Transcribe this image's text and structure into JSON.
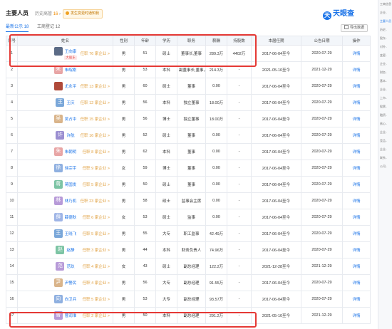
{
  "header": {
    "title": "主要人员",
    "history_label": "历史高管",
    "history_count": "16",
    "notice": "发生变更时通知我",
    "logo": "天眼查"
  },
  "tabs": [
    {
      "label": "最新公示 18",
      "active": true
    },
    {
      "label": "工商登记 12",
      "active": false
    }
  ],
  "export_label": "导出数据",
  "table": {
    "headers": [
      "序号",
      "姓名",
      "性别",
      "年龄",
      "学历",
      "职务",
      "薪酬",
      "持股数",
      "本届任期",
      "公告日期",
      "操作"
    ],
    "rows": [
      {
        "no": "1",
        "avatar_text": "",
        "avatar_color": "#5b6b86",
        "name": "王向康",
        "tag": "大股东",
        "companies": "任职 76 家企业 >",
        "gender": "男",
        "age": "51",
        "edu": "硕士",
        "role": "董事长,董事",
        "pay": "289.3万",
        "shares": "4402万",
        "term": "2017-06-04至今",
        "date": "2020-07-29",
        "op": "详情"
      },
      {
        "no": "2",
        "avatar_text": "朱",
        "avatar_color": "#e8a5a5",
        "name": "朱皖刚",
        "tag": "",
        "companies": "",
        "gender": "男",
        "age": "53",
        "edu": "本科",
        "role": "副董事长,董事,总经理",
        "pay": "214.3万",
        "shares": "-",
        "term": "2021-05-10至今",
        "date": "2021-12-29",
        "op": "详情"
      },
      {
        "no": "3",
        "avatar_text": "",
        "avatar_color": "#b04a3a",
        "name": "尤永平",
        "tag": "",
        "companies": "任职 13 家企业 >",
        "gender": "男",
        "age": "60",
        "edu": "硕士",
        "role": "董事",
        "pay": "0.00",
        "shares": "-",
        "term": "2017-06-04至今",
        "date": "2020-07-29",
        "op": "详情"
      },
      {
        "no": "4",
        "avatar_text": "王",
        "avatar_color": "#7aa7d9",
        "name": "王庆",
        "tag": "",
        "companies": "任职 12 家企业 >",
        "gender": "男",
        "age": "56",
        "edu": "本科",
        "role": "独立董事",
        "pay": "18.00万",
        "shares": "-",
        "term": "2017-06-04至今",
        "date": "2020-07-29",
        "op": "详情"
      },
      {
        "no": "5",
        "avatar_text": "吴",
        "avatar_color": "#d9b48a",
        "name": "吴占中",
        "tag": "",
        "companies": "任职 15 家企业 >",
        "gender": "男",
        "age": "56",
        "edu": "博士",
        "role": "独立董事",
        "pay": "18.00万",
        "shares": "-",
        "term": "2017-06-04至今",
        "date": "2020-07-29",
        "op": "详情"
      },
      {
        "no": "6",
        "avatar_text": "许",
        "avatar_color": "#9b8fd1",
        "name": "许航",
        "tag": "",
        "companies": "任职 16 家企业 >",
        "gender": "男",
        "age": "52",
        "edu": "硕士",
        "role": "董事",
        "pay": "0.00",
        "shares": "-",
        "term": "2017-06-04至今",
        "date": "2020-07-29",
        "op": "详情"
      },
      {
        "no": "7",
        "avatar_text": "朱",
        "avatar_color": "#e8a5a5",
        "name": "朱朝明",
        "tag": "",
        "companies": "任职 8 家企业 >",
        "gender": "男",
        "age": "62",
        "edu": "本科",
        "role": "董事",
        "pay": "0.00",
        "shares": "-",
        "term": "2017-06-04至今",
        "date": "2020-07-29",
        "op": "详情"
      },
      {
        "no": "8",
        "avatar_text": "徐",
        "avatar_color": "#8fb0e0",
        "name": "徐宗宇",
        "tag": "",
        "companies": "任职 9 家企业 >",
        "gender": "女",
        "age": "59",
        "edu": "博士",
        "role": "董事",
        "pay": "0.00",
        "shares": "-",
        "term": "2017-06-04至今",
        "date": "2020-07-29",
        "op": "详情"
      },
      {
        "no": "9",
        "avatar_text": "蒋",
        "avatar_color": "#7cc4a4",
        "name": "蒋国发",
        "tag": "",
        "companies": "任职 5 家企业 >",
        "gender": "男",
        "age": "50",
        "edu": "硕士",
        "role": "董事",
        "pay": "0.00",
        "shares": "-",
        "term": "2017-06-04至今",
        "date": "2020-07-29",
        "op": "详情"
      },
      {
        "no": "10",
        "avatar_text": "林",
        "avatar_color": "#b79ad8",
        "name": "林乃机",
        "tag": "",
        "companies": "任职 23 家企业 >",
        "gender": "男",
        "age": "58",
        "edu": "硕士",
        "role": "监事会主席",
        "pay": "0.00",
        "shares": "-",
        "term": "2017-06-04至今",
        "date": "2020-07-29",
        "op": "详情"
      },
      {
        "no": "11",
        "avatar_text": "薛",
        "avatar_color": "#9fb5e6",
        "name": "薛德秋",
        "tag": "",
        "companies": "任职 6 家企业 >",
        "gender": "女",
        "age": "53",
        "edu": "硕士",
        "role": "监事",
        "pay": "0.00",
        "shares": "-",
        "term": "2017-06-04至今",
        "date": "2020-07-29",
        "op": "详情"
      },
      {
        "no": "12",
        "avatar_text": "王",
        "avatar_color": "#7aa7d9",
        "name": "王晓飞",
        "tag": "",
        "companies": "任职 5 家企业 >",
        "gender": "男",
        "age": "55",
        "edu": "大专",
        "role": "职工监事",
        "pay": "42.49万",
        "shares": "-",
        "term": "2017-06-04至今",
        "date": "2020-07-29",
        "op": "详情"
      },
      {
        "no": "13",
        "avatar_text": "赵",
        "avatar_color": "#7cc4a4",
        "name": "赵静",
        "tag": "",
        "companies": "任职 3 家企业 >",
        "gender": "男",
        "age": "44",
        "edu": "本科",
        "role": "财务负责人",
        "pay": "74.96万",
        "shares": "-",
        "term": "2017-06-04至今",
        "date": "2020-07-29",
        "op": "详情"
      },
      {
        "no": "14",
        "avatar_text": "范",
        "avatar_color": "#b79ad8",
        "name": "范玖",
        "tag": "",
        "companies": "任职 4 家企业 >",
        "gender": "女",
        "age": "43",
        "edu": "硕士",
        "role": "副总经理",
        "pay": "122.2万",
        "shares": "-",
        "term": "2021-12-28至今",
        "date": "2021-12-29",
        "op": "详情"
      },
      {
        "no": "15",
        "avatar_text": "尹",
        "avatar_color": "#d9b48a",
        "name": "尹警民",
        "tag": "",
        "companies": "任职 4 家企业 >",
        "gender": "男",
        "age": "56",
        "edu": "大专",
        "role": "副总经理",
        "pay": "91.55万",
        "shares": "-",
        "term": "2017-06-04至今",
        "date": "2020-07-29",
        "op": "详情"
      },
      {
        "no": "16",
        "avatar_text": "向",
        "avatar_color": "#8fb0e0",
        "name": "向卫兵",
        "tag": "",
        "companies": "任职 5 家企业 >",
        "gender": "男",
        "age": "53",
        "edu": "大专",
        "role": "副总经理",
        "pay": "93.57万",
        "shares": "-",
        "term": "2017-06-04至今",
        "date": "2020-07-29",
        "op": "详情"
      },
      {
        "no": "17",
        "avatar_text": "曹",
        "avatar_color": "#b79ad8",
        "name": "曹润淮",
        "tag": "",
        "companies": "任职 2 家企业 >",
        "gender": "男",
        "age": "50",
        "edu": "本科",
        "role": "副总经理",
        "pay": "291.2万",
        "shares": "-",
        "term": "2021-05-10至今",
        "date": "2021-12-29",
        "op": "详情"
      }
    ]
  },
  "sidebar": {
    "items": [
      "工商信息",
      "企业..",
      "主要人员",
      "历史..",
      "股东..",
      "对外..",
      "变更..",
      "企业..",
      "财务..",
      "基本..",
      "企业..",
      "上市..",
      "股票..",
      "融资..",
      "核心..",
      "企业..",
      "竞品..",
      "企业..",
      "联系..",
      "公司.."
    ]
  }
}
